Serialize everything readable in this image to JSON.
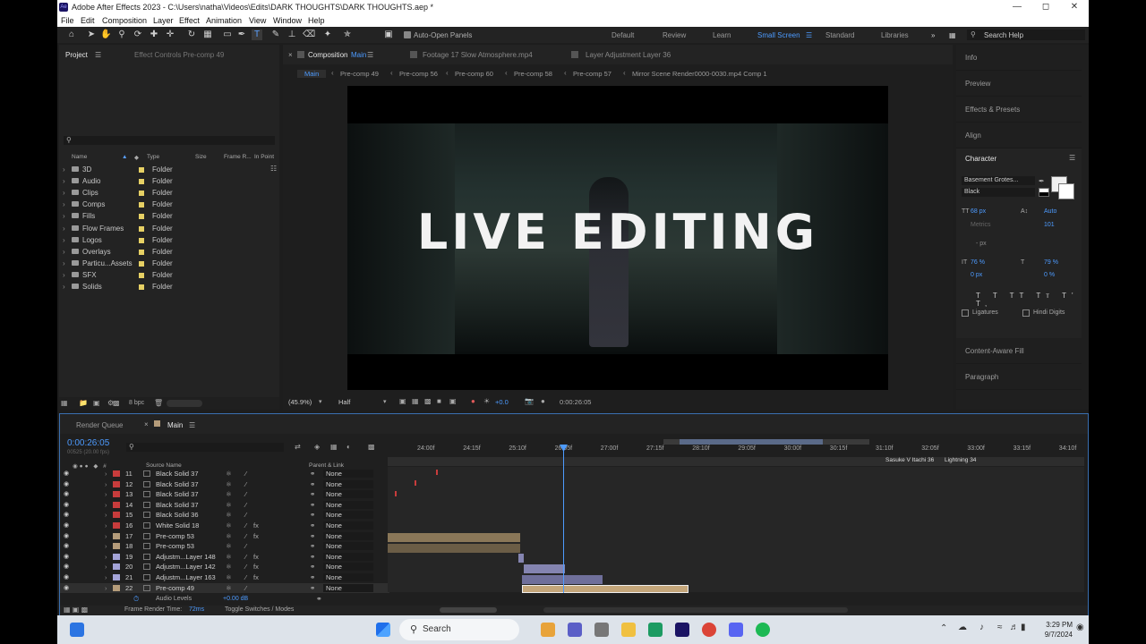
{
  "window": {
    "title": "Adobe After Effects 2023 - C:\\Users\\natha\\Videos\\Edits\\DARK THOUGHTS\\DARK THOUGHTS.aep *",
    "app_badge": "Ae"
  },
  "menu": [
    "File",
    "Edit",
    "Composition",
    "Layer",
    "Effect",
    "Animation",
    "View",
    "Window",
    "Help"
  ],
  "toolbar": {
    "auto_open": "Auto-Open Panels",
    "workspaces": [
      "Default",
      "Review",
      "Learn",
      "Small Screen",
      "Standard",
      "Libraries"
    ],
    "search": "Search Help"
  },
  "project": {
    "tab": "Project",
    "effect_controls": "Effect Controls Pre-comp 49",
    "columns": [
      "Name",
      "Type",
      "Size",
      "Frame R...",
      "In Point"
    ],
    "items": [
      {
        "name": "3D",
        "type": "Folder"
      },
      {
        "name": "Audio",
        "type": "Folder"
      },
      {
        "name": "Clips",
        "type": "Folder"
      },
      {
        "name": "Comps",
        "type": "Folder"
      },
      {
        "name": "Fills",
        "type": "Folder"
      },
      {
        "name": "Flow Frames",
        "type": "Folder"
      },
      {
        "name": "Logos",
        "type": "Folder"
      },
      {
        "name": "Overlays",
        "type": "Folder"
      },
      {
        "name": "Particu...Assets",
        "type": "Folder"
      },
      {
        "name": "SFX",
        "type": "Folder"
      },
      {
        "name": "Solids",
        "type": "Folder"
      }
    ],
    "bpc": "8 bpc"
  },
  "composition": {
    "tab_label": "Composition",
    "tab_name": "Main",
    "footage_tab": "Footage 17 Slow Atmosphere.mp4",
    "layer_tab": "Layer Adjustment Layer 36",
    "breadcrumbs": [
      "Main",
      "Pre-comp 49",
      "Pre-comp 56",
      "Pre-comp 60",
      "Pre-comp 58",
      "Pre-comp 57",
      "Mirror Scene Render0000-0030.mp4 Comp 1"
    ],
    "overlay_text": "LIVE EDITING",
    "zoom": "(45.9%)",
    "resolution": "Half",
    "exposure": "+0.0",
    "timecode": "0:00:26:05"
  },
  "right_panel": {
    "items": [
      "Info",
      "Preview",
      "Effects & Presets",
      "Align"
    ],
    "character": {
      "title": "Character",
      "font": "Basement Grotes...",
      "style": "Black",
      "size": "68 px",
      "leading": "Auto",
      "kerning": "Metrics",
      "tracking": "101",
      "indent": "- px",
      "vscale": "76 %",
      "hscale": "79 %",
      "baseline": "0 px",
      "tsume": "0 %",
      "ligatures": "Ligatures",
      "hindi": "Hindi Digits"
    },
    "bottom_items": [
      "Content-Aware Fill",
      "Paragraph"
    ]
  },
  "timeline": {
    "render_queue": "Render Queue",
    "comp_tab": "Main",
    "timecode": "0:00:26:05",
    "timecode_sub": "00525 (20.00 fps)",
    "col_source": "Source Name",
    "col_parent": "Parent & Link",
    "ruler": [
      "24:00f",
      "24:15f",
      "25:10f",
      "26:05f",
      "27:00f",
      "27:15f",
      "28:10f",
      "29:05f",
      "30:00f",
      "30:15f",
      "31:10f",
      "32:05f",
      "33:00f",
      "33:15f",
      "34:10f"
    ],
    "layers": [
      {
        "num": "11",
        "name": "Black Solid 37",
        "color": "#c83c3c",
        "fx": "",
        "parent": "None"
      },
      {
        "num": "12",
        "name": "Black Solid 37",
        "color": "#c83c3c",
        "fx": "",
        "parent": "None"
      },
      {
        "num": "13",
        "name": "Black Solid 37",
        "color": "#c83c3c",
        "fx": "",
        "parent": "None"
      },
      {
        "num": "14",
        "name": "Black Solid 37",
        "color": "#c83c3c",
        "fx": "",
        "parent": "None"
      },
      {
        "num": "15",
        "name": "Black Solid 36",
        "color": "#c83c3c",
        "fx": "",
        "parent": "None"
      },
      {
        "num": "16",
        "name": "White Solid 18",
        "color": "#c83c3c",
        "fx": "fx",
        "parent": "None"
      },
      {
        "num": "17",
        "name": "Pre-comp 53",
        "color": "#b59c7a",
        "fx": "fx",
        "parent": "None"
      },
      {
        "num": "18",
        "name": "Pre-comp 53",
        "color": "#b59c7a",
        "fx": "",
        "parent": "None"
      },
      {
        "num": "19",
        "name": "Adjustm...Layer 148",
        "color": "#a4a4d8",
        "fx": "fx",
        "parent": "None"
      },
      {
        "num": "20",
        "name": "Adjustm...Layer 142",
        "color": "#a4a4d8",
        "fx": "fx",
        "parent": "None"
      },
      {
        "num": "21",
        "name": "Adjustm...Layer 163",
        "color": "#a4a4d8",
        "fx": "fx",
        "parent": "None"
      },
      {
        "num": "22",
        "name": "Pre-comp 49",
        "color": "#b59c7a",
        "fx": "",
        "parent": "None"
      }
    ],
    "audio_levels": "Audio Levels",
    "audio_value": "+0.00 dB",
    "frame_render": "Frame Render Time:",
    "frame_render_val": "72ms",
    "toggle": "Toggle Switches / Modes",
    "marker_labels": [
      "Sasuke V Itachi 36",
      "Lightning 34"
    ]
  },
  "taskbar": {
    "search": "Search",
    "time": "3:29 PM",
    "date": "9/7/2024"
  }
}
